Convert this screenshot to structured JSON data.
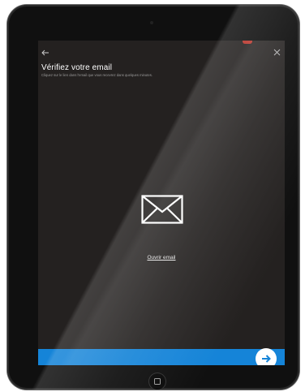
{
  "screen": {
    "title": "Vérifiez votre email",
    "subtitle": "Cliquez sur le lien dans l'email que vous recevrez dans quelques minutes.",
    "open_email_label": "Ouvrir email",
    "icons": {
      "back": "arrow-left-icon",
      "close": "close-icon",
      "envelope": "envelope-icon",
      "next": "arrow-right-icon"
    }
  },
  "colors": {
    "screen_background": "#242120",
    "accent_bar": "#1584d8",
    "title_text": "#ffffff",
    "subtitle_text": "#9a9a9a",
    "device_frame": "#101010"
  }
}
